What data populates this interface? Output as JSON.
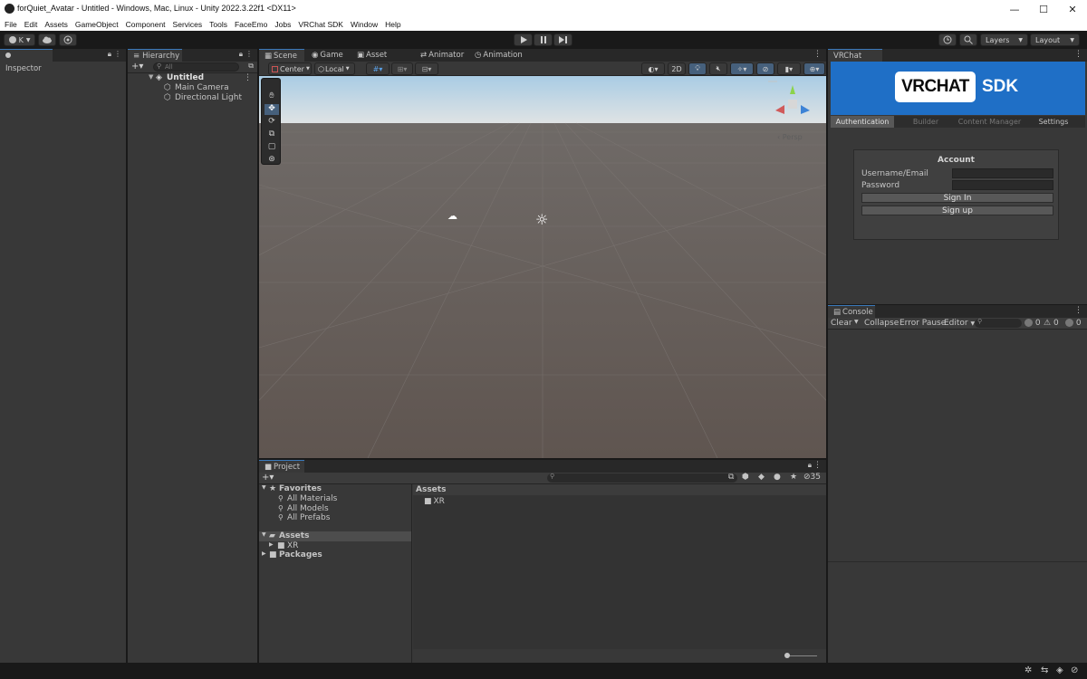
{
  "window": {
    "title": "forQuiet_Avatar - Untitled - Windows, Mac, Linux - Unity 2022.3.22f1 <DX11>",
    "minimize": "—",
    "maximize": "☐",
    "close": "✕"
  },
  "menu": [
    "File",
    "Edit",
    "Assets",
    "GameObject",
    "Component",
    "Services",
    "Tools",
    "FaceEmo",
    "Jobs",
    "VRChat SDK",
    "Window",
    "Help"
  ],
  "toolbar": {
    "account_label": "K",
    "layers_label": "Layers",
    "layout_label": "Layout"
  },
  "inspector": {
    "tab": "Inspector"
  },
  "hierarchy": {
    "tab": "Hierarchy",
    "search_placeholder": "All",
    "scene_name": "Untitled",
    "items": [
      "Main Camera",
      "Directional Light"
    ]
  },
  "scene_tabs": [
    "Scene",
    "Game",
    "Asset Store",
    "Animator",
    "Animation"
  ],
  "scene_toolbar": {
    "pivot_label": "Center",
    "space_label": "Local",
    "mode_2d_label": "2D",
    "persp_label": "Persp"
  },
  "vrchat": {
    "tab": "VRChat SDK",
    "logo_vr": "VRCHAT",
    "logo_sdk": "SDK",
    "tabs": [
      "Authentication",
      "Builder",
      "Content Manager",
      "Settings"
    ],
    "account_title": "Account",
    "username_label": "Username/Email",
    "password_label": "Password",
    "signin_label": "Sign In",
    "signup_label": "Sign up"
  },
  "console": {
    "tab": "Console",
    "clear_label": "Clear",
    "collapse_label": "Collapse",
    "error_pause_label": "Error Pause",
    "editor_label": "Editor",
    "count_log": "0",
    "count_warn": "0",
    "count_error": "0"
  },
  "project": {
    "tab": "Project",
    "hidden_count": "35",
    "favorites_label": "Favorites",
    "favorites": [
      "All Materials",
      "All Models",
      "All Prefabs"
    ],
    "assets_label": "Assets",
    "assets_children": [
      "XR"
    ],
    "packages_label": "Packages",
    "breadcrumb": "Assets",
    "grid_items": [
      "XR"
    ]
  },
  "colors": {
    "accent": "#3a79bb",
    "vrchat_blue": "#1f6fc6",
    "panel": "#383838",
    "dark": "#282828"
  }
}
